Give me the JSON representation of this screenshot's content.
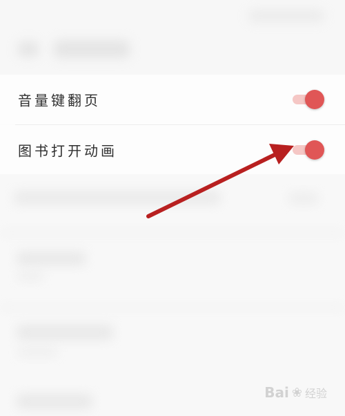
{
  "settings": {
    "items": [
      {
        "label": "音量键翻页",
        "enabled": true
      },
      {
        "label": "图书打开动画",
        "enabled": true
      }
    ]
  },
  "watermark": {
    "brand": "Bai",
    "paw": "❀",
    "text": "经验"
  },
  "colors": {
    "toggle_on": "#e05656",
    "toggle_track": "#f5c7c5",
    "arrow": "#b82020"
  }
}
